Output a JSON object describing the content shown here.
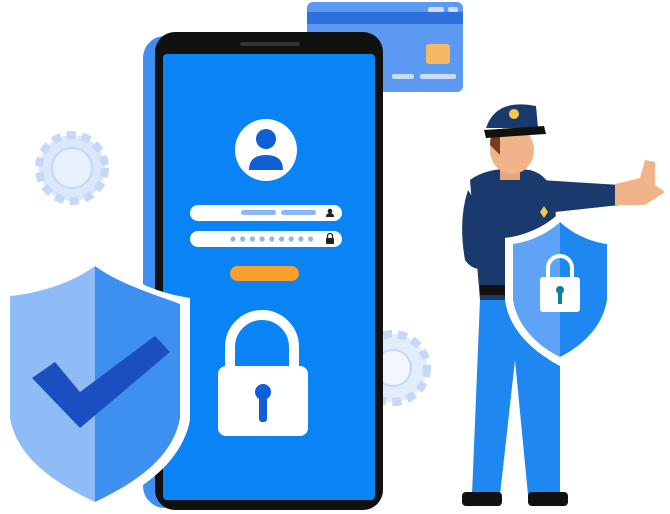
{
  "illustration": {
    "theme": "mobile login security",
    "password_dot_count": 9,
    "colors": {
      "primary_blue": "#0a84f5",
      "dark_blue": "#0f5fd6",
      "light_blue": "#8bb7f5",
      "navy": "#1a3a6e",
      "orange": "#f7a02e",
      "phone_frame": "#111111",
      "gear": "#dbe8fb",
      "skin": "#f1b48a"
    }
  }
}
